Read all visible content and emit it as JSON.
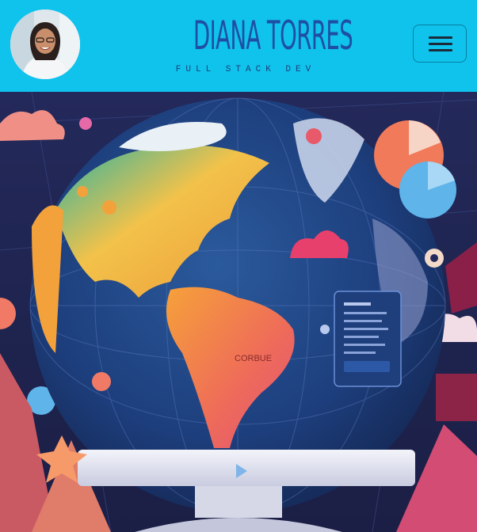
{
  "header": {
    "name": "DIANA TORRES",
    "role": "FULL STACK DEV",
    "avatar_icon": "person-photo-icon",
    "menu_icon": "hamburger-icon"
  },
  "hero": {
    "image_icon": "globe-illustration",
    "map_label": "CORBUE",
    "colors": {
      "header_bg": "#0fc3ec",
      "brand_text": "#1f4fa3",
      "ocean": "#1d3e7c",
      "north_america": "#f0b03a",
      "south_america": "#ee6a5a"
    }
  }
}
